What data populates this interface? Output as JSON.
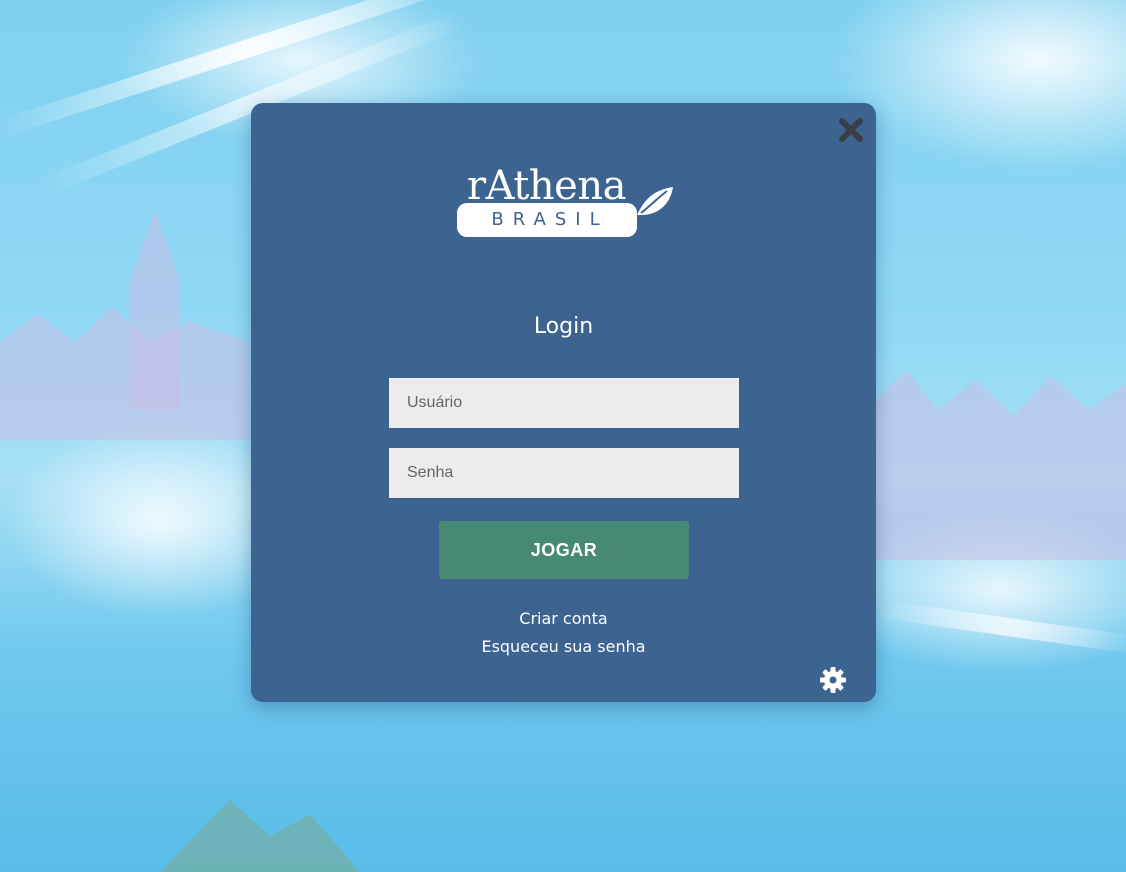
{
  "brand": {
    "name": "rAthena",
    "sub": "BRASIL"
  },
  "login": {
    "title": "Login",
    "username_placeholder": "Usuário",
    "password_placeholder": "Senha",
    "submit_label": "JOGAR",
    "create_account_label": "Criar conta",
    "forgot_password_label": "Esqueceu sua senha"
  },
  "icons": {
    "close": "close-icon",
    "settings": "gear-icon",
    "leaf": "leaf-icon"
  },
  "colors": {
    "modal_bg": "#3d6390",
    "submit_bg": "#468a76",
    "input_bg": "#ececec",
    "text": "#ffffff",
    "icon_dark": "#3a3f47"
  }
}
